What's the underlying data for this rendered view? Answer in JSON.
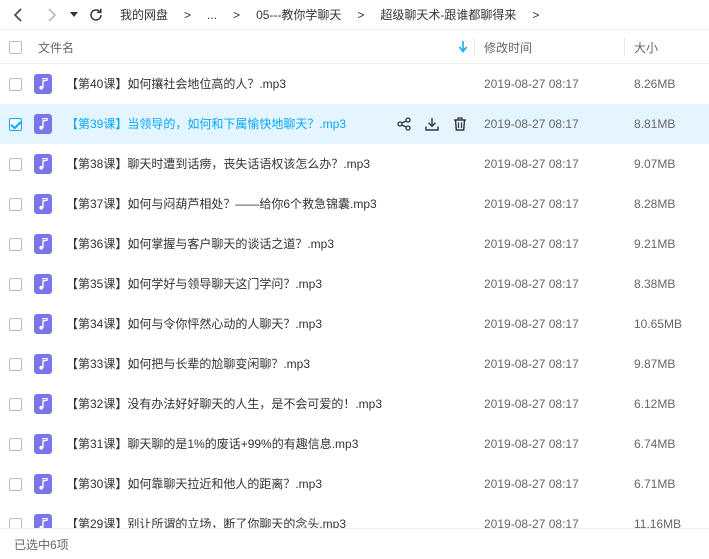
{
  "breadcrumb": [
    "我的网盘",
    "...",
    "05---教你学聊天",
    "超级聊天术-跟谁都聊得来"
  ],
  "breadcrumb_separator": ">",
  "columns": {
    "name": "文件名",
    "modified": "修改时间",
    "size": "大小"
  },
  "files": [
    {
      "name": "【第40课】如何攘社会地位高的人？.mp3",
      "date": "2019-08-27 08:17",
      "size": "8.26MB",
      "selected": false
    },
    {
      "name": "【第39课】当领导的，如何和下属愉快地聊天？.mp3",
      "date": "2019-08-27 08:17",
      "size": "8.81MB",
      "selected": true
    },
    {
      "name": "【第38课】聊天时遭到话痨，丧失话语权该怎么办？.mp3",
      "date": "2019-08-27 08:17",
      "size": "9.07MB",
      "selected": false
    },
    {
      "name": "【第37课】如何与闷葫芦相处？——给你6个救急锦囊.mp3",
      "date": "2019-08-27 08:17",
      "size": "8.28MB",
      "selected": false
    },
    {
      "name": "【第36课】如何掌握与客户聊天的谈话之道？.mp3",
      "date": "2019-08-27 08:17",
      "size": "9.21MB",
      "selected": false
    },
    {
      "name": "【第35课】如何学好与领导聊天这门学问？.mp3",
      "date": "2019-08-27 08:17",
      "size": "8.38MB",
      "selected": false
    },
    {
      "name": "【第34课】如何与令你怦然心动的人聊天？.mp3",
      "date": "2019-08-27 08:17",
      "size": "10.65MB",
      "selected": false
    },
    {
      "name": "【第33课】如何把与长辈的尬聊变闲聊？.mp3",
      "date": "2019-08-27 08:17",
      "size": "9.87MB",
      "selected": false
    },
    {
      "name": "【第32课】没有办法好好聊天的人生，是不会可爱的！.mp3",
      "date": "2019-08-27 08:17",
      "size": "6.12MB",
      "selected": false
    },
    {
      "name": "【第31课】聊天聊的是1%的废话+99%的有趣信息.mp3",
      "date": "2019-08-27 08:17",
      "size": "6.74MB",
      "selected": false
    },
    {
      "name": "【第30课】如何靠聊天拉近和他人的距离？.mp3",
      "date": "2019-08-27 08:17",
      "size": "6.71MB",
      "selected": false
    },
    {
      "name": "【第29课】别让所谓的立场，断了你聊天的念头.mp3",
      "date": "2019-08-27 08:17",
      "size": "11.16MB",
      "selected": false
    }
  ],
  "status": "已选中6项",
  "icons": {
    "back": "chevron-left-icon",
    "forward": "chevron-right-icon",
    "dropdown": "caret-down-icon",
    "refresh": "refresh-icon",
    "sort": "sort-down-arrow-icon",
    "file": "music-file-icon",
    "share": "share-icon",
    "download": "download-icon",
    "delete": "trash-icon"
  },
  "colors": {
    "accent": "#06a7ff",
    "selected_row": "#e5f5ff",
    "file_icon": "#7c74e9"
  }
}
